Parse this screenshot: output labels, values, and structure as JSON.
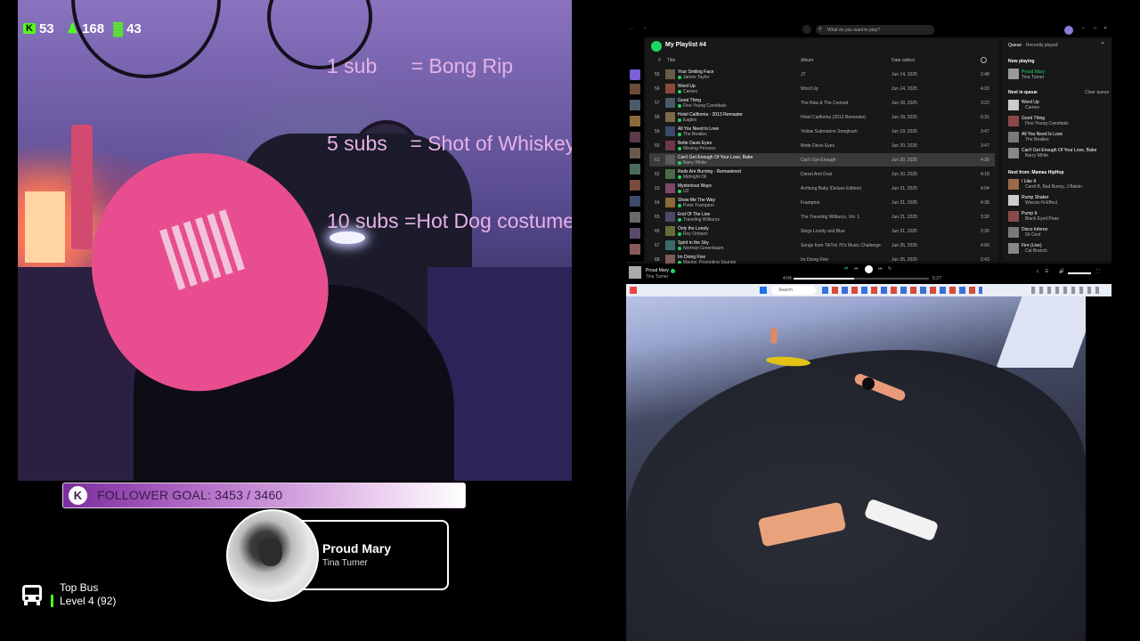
{
  "overlay": {
    "stats": [
      {
        "icon": "kick-logo-icon",
        "value": "53"
      },
      {
        "icon": "followers-icon",
        "value": "168"
      },
      {
        "icon": "bars-icon",
        "value": "43"
      }
    ],
    "sub_goals": [
      "1 sub      = Bong Rip",
      "5 subs    = Shot of Whiskey",
      "10 subs =Hot Dog costume"
    ],
    "follower_goal": {
      "label": "FOLLOWER GOAL: 3453 / 3460",
      "current": 3453,
      "target": 3460,
      "badge": "K"
    },
    "now_playing": {
      "title": "Proud Mary",
      "artist": "Tina Turner"
    },
    "top_bus": {
      "title": "Top Bus",
      "level": "Level 4",
      "score": "(92)"
    }
  },
  "spotify": {
    "search_placeholder": "What do you want to play?",
    "playlist_title": "My Playlist #4",
    "columns": [
      "#",
      "Title",
      "Album",
      "Date added"
    ],
    "tracks": [
      {
        "n": "55",
        "title": "Your Smiling Face",
        "artist": "James Taylor",
        "album": "JT",
        "date": "Jun 14, 2025",
        "dur": "2:48"
      },
      {
        "n": "56",
        "title": "Word Up",
        "artist": "Cameo",
        "album": "Word Up",
        "date": "Jun 14, 2025",
        "dur": "4:20"
      },
      {
        "n": "57",
        "title": "Good Thing",
        "artist": "Fine Young Cannibals",
        "album": "The Raw & The Cooked",
        "date": "Jun 18, 2025",
        "dur": "3:22"
      },
      {
        "n": "58",
        "title": "Hotel California - 2013 Remaster",
        "artist": "Eagles",
        "album": "Hotel California (2013 Remaster)",
        "date": "Jun 18, 2025",
        "dur": "6:31"
      },
      {
        "n": "59",
        "title": "All You Need Is Love",
        "artist": "The Beatles",
        "album": "Yellow Submarine Songtrack",
        "date": "Jun 19, 2025",
        "dur": "3:47"
      },
      {
        "n": "60",
        "title": "Bette Davis Eyes",
        "artist": "Missing Persons",
        "album": "Bette Davis Eyes",
        "date": "Jun 20, 2025",
        "dur": "3:47"
      },
      {
        "n": "61",
        "title": "Can't Get Enough Of Your Love, Babe",
        "artist": "Barry White",
        "album": "Can't Get Enough",
        "date": "Jun 20, 2025",
        "dur": "4:30"
      },
      {
        "n": "62",
        "title": "Reds Are Burning - Remastered",
        "artist": "Midnight Oil",
        "album": "Diesel And Dust",
        "date": "Jun 20, 2025",
        "dur": "4:18"
      },
      {
        "n": "63",
        "title": "Mysterious Ways",
        "artist": "U2",
        "album": "Achtung Baby (Deluxe Edition)",
        "date": "Jun 21, 2025",
        "dur": "4:04"
      },
      {
        "n": "64",
        "title": "Show Me The Way",
        "artist": "Peter Frampton",
        "album": "Frampton",
        "date": "Jun 21, 2025",
        "dur": "4:38"
      },
      {
        "n": "65",
        "title": "End Of The Line",
        "artist": "Traveling Wilburys",
        "album": "The Traveling Wilburys, Vol. 1",
        "date": "Jun 21, 2025",
        "dur": "3:30"
      },
      {
        "n": "66",
        "title": "Only the Lonely",
        "artist": "Roy Orbison",
        "album": "Sings Lonely and Blue",
        "date": "Jun 21, 2025",
        "dur": "2:26"
      },
      {
        "n": "67",
        "title": "Spirit in the Sky",
        "artist": "Norman Greenbaum",
        "album": "Songs from TikTok 70's Music Challenge",
        "date": "Jun 26, 2025",
        "dur": "4:00"
      },
      {
        "n": "68",
        "title": "Im Doing Fine",
        "artist": "Marino, Promoting Sounds",
        "album": "Im Doing Fine",
        "date": "Jun 26, 2025",
        "dur": "2:43"
      }
    ],
    "queue": {
      "tabs": [
        "Queue",
        "Recently played"
      ],
      "now_playing_label": "Now playing",
      "now": {
        "title": "Proud Mary",
        "artist": "Tina Turner"
      },
      "next_label": "Next in queue",
      "clear_label": "Clear queue",
      "next": [
        {
          "title": "Word Up",
          "artist": "Cameo"
        },
        {
          "title": "Good Thing",
          "artist": "Fine Young Cannibals"
        },
        {
          "title": "All You Need Is Love",
          "artist": "The Beatles"
        },
        {
          "title": "Can't Get Enough Of Your Love, Babe",
          "artist": "Barry White"
        }
      ],
      "from_label": "Next from: Mamas HipHop",
      "from": [
        {
          "title": "I Like It",
          "artist": "Cardi B, Bad Bunny, J Balvin"
        },
        {
          "title": "Rump Shaker",
          "artist": "Wreckx-N-Effect"
        },
        {
          "title": "Pump It",
          "artist": "Black Eyed Peas"
        },
        {
          "title": "Disco Inferno",
          "artist": "50 Cent"
        },
        {
          "title": "Fire (Live)",
          "artist": "Cal Branch"
        }
      ]
    },
    "player": {
      "title": "Proud Mary",
      "artist": "Tina Turner",
      "elapsed": "4:04",
      "total": "5:27",
      "progress": 0.45
    },
    "taskbar_search": "Search"
  },
  "colors": {
    "kick_green": "#53fc18",
    "sign_pink": "#e7b1e7",
    "spotify_bg": "#121212",
    "spotify_green": "#1ed760"
  }
}
